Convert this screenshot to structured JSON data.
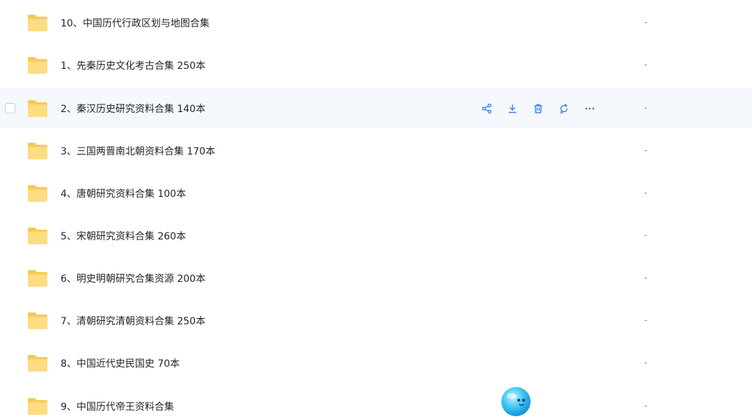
{
  "files": [
    {
      "name": "10、中国历代行政区划与地图合集",
      "size": "-",
      "icon": "folder-icon"
    },
    {
      "name": "1、先秦历史文化考古合集 250本",
      "size": "-",
      "icon": "folder-icon"
    },
    {
      "name": "2、秦汉历史研究资料合集 140本",
      "size": "-",
      "icon": "folder-icon",
      "hovered": true
    },
    {
      "name": "3、三国两晋南北朝资料合集 170本",
      "size": "-",
      "icon": "folder-icon"
    },
    {
      "name": "4、唐朝研究资料合集 100本",
      "size": "-",
      "icon": "folder-icon"
    },
    {
      "name": "5、宋朝研究资料合集 260本",
      "size": "-",
      "icon": "folder-icon"
    },
    {
      "name": "6、明史明朝研究合集资源 200本",
      "size": "-",
      "icon": "folder-icon"
    },
    {
      "name": "7、清朝研究清朝资料合集 250本",
      "size": "-",
      "icon": "folder-icon"
    },
    {
      "name": "8、中国近代史民国史 70本",
      "size": "-",
      "icon": "folder-icon"
    },
    {
      "name": "9、中国历代帝王资料合集",
      "size": "-",
      "icon": "folder-icon"
    }
  ],
  "row_actions": [
    "share-icon",
    "download-icon",
    "delete-icon",
    "refresh-icon",
    "more-icon"
  ],
  "colors": {
    "folder": "#f9c84a",
    "folder_light": "#fddd83",
    "accent": "#3b7ff0",
    "hover_bg": "#f5f8fd",
    "text": "#1f2329",
    "muted": "#8a8f99"
  },
  "mascot": {
    "icon": "assistant-mascot-icon"
  }
}
